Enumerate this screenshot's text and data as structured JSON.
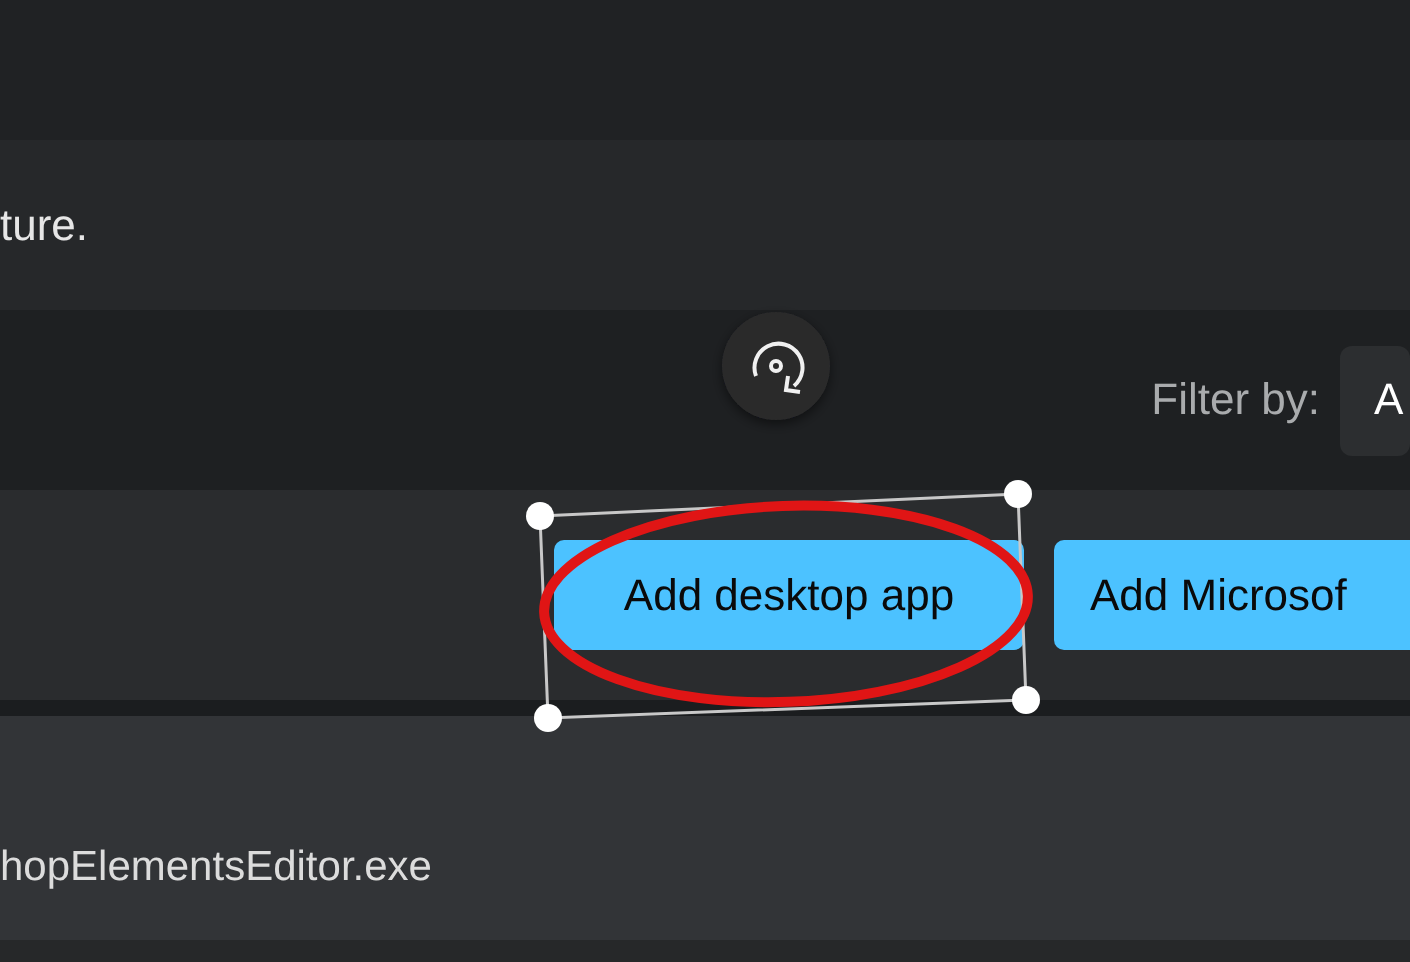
{
  "description": {
    "text": "ture."
  },
  "filter": {
    "label": "Filter by:",
    "value": "A"
  },
  "buttons": [
    {
      "label": "Add desktop app"
    },
    {
      "label": "Add Microsof"
    }
  ],
  "app_row": {
    "path": "hopElementsEditor.exe"
  }
}
